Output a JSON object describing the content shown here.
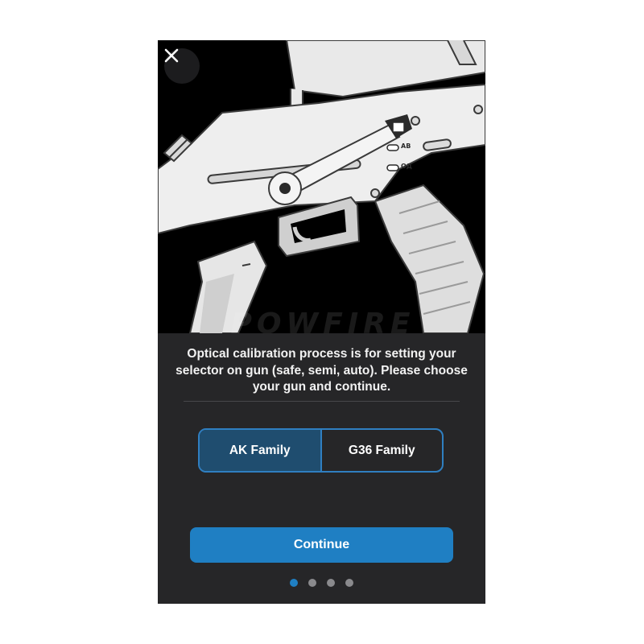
{
  "hero": {
    "watermark": "POWFIRE",
    "selector_marks": {
      "upper": "AB",
      "lower": "ОД"
    }
  },
  "description": "Optical calibration process is for setting your selector on gun (safe, semi, auto). Please choose your gun and continue.",
  "gun_options": {
    "items": [
      {
        "label": "AK Family",
        "selected": true
      },
      {
        "label": "G36 Family",
        "selected": false
      }
    ]
  },
  "continue_label": "Continue",
  "pagination": {
    "total": 4,
    "current": 1
  },
  "colors": {
    "accent": "#1f7fc3",
    "segment_border": "#2f7fc1",
    "segment_selected": "#1f4d6f",
    "panel_background": "#262628",
    "hero_background": "#000000"
  },
  "icons": {
    "close": "close-icon"
  }
}
